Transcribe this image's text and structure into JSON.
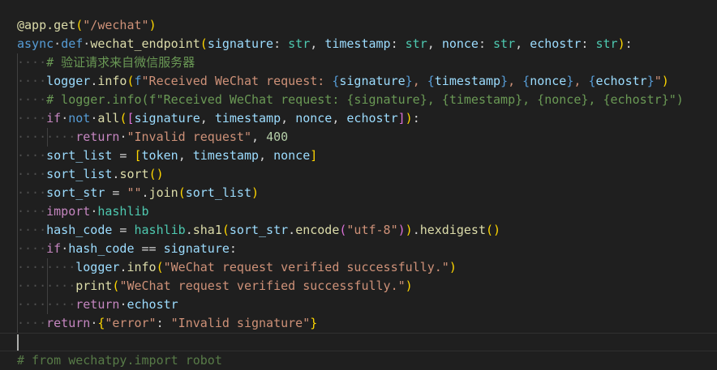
{
  "editor": {
    "lines": [
      {
        "indent": 0,
        "tokens": [
          {
            "t": "@app.get",
            "c": "decorator"
          },
          {
            "t": "(",
            "c": "b1"
          },
          {
            "t": "\"/wechat\"",
            "c": "string"
          },
          {
            "t": ")",
            "c": "b1"
          }
        ]
      },
      {
        "indent": 0,
        "tokens": [
          {
            "t": "async",
            "c": "keyword"
          },
          {
            "t": " ",
            "c": "ws"
          },
          {
            "t": "def",
            "c": "keyword"
          },
          {
            "t": " ",
            "c": "ws"
          },
          {
            "t": "wechat_endpoint",
            "c": "func"
          },
          {
            "t": "(",
            "c": "b1"
          },
          {
            "t": "signature",
            "c": "var"
          },
          {
            "t": ": ",
            "c": "op"
          },
          {
            "t": "str",
            "c": "type"
          },
          {
            "t": ", ",
            "c": "op"
          },
          {
            "t": "timestamp",
            "c": "var"
          },
          {
            "t": ": ",
            "c": "op"
          },
          {
            "t": "str",
            "c": "type"
          },
          {
            "t": ", ",
            "c": "op"
          },
          {
            "t": "nonce",
            "c": "var"
          },
          {
            "t": ": ",
            "c": "op"
          },
          {
            "t": "str",
            "c": "type"
          },
          {
            "t": ", ",
            "c": "op"
          },
          {
            "t": "echostr",
            "c": "var"
          },
          {
            "t": ": ",
            "c": "op"
          },
          {
            "t": "str",
            "c": "type"
          },
          {
            "t": ")",
            "c": "b1"
          },
          {
            "t": ":",
            "c": "op"
          }
        ]
      },
      {
        "indent": 1,
        "tokens": [
          {
            "t": "# 验证请求来自微信服务器",
            "c": "comment"
          }
        ]
      },
      {
        "indent": 1,
        "tokens": [
          {
            "t": "logger",
            "c": "var"
          },
          {
            "t": ".",
            "c": "op"
          },
          {
            "t": "info",
            "c": "func"
          },
          {
            "t": "(",
            "c": "b1"
          },
          {
            "t": "f",
            "c": "keyword"
          },
          {
            "t": "\"Received WeChat request: ",
            "c": "string"
          },
          {
            "t": "{",
            "c": "keyword"
          },
          {
            "t": "signature",
            "c": "var"
          },
          {
            "t": "}",
            "c": "keyword"
          },
          {
            "t": ", ",
            "c": "string"
          },
          {
            "t": "{",
            "c": "keyword"
          },
          {
            "t": "timestamp",
            "c": "var"
          },
          {
            "t": "}",
            "c": "keyword"
          },
          {
            "t": ", ",
            "c": "string"
          },
          {
            "t": "{",
            "c": "keyword"
          },
          {
            "t": "nonce",
            "c": "var"
          },
          {
            "t": "}",
            "c": "keyword"
          },
          {
            "t": ", ",
            "c": "string"
          },
          {
            "t": "{",
            "c": "keyword"
          },
          {
            "t": "echostr",
            "c": "var"
          },
          {
            "t": "}",
            "c": "keyword"
          },
          {
            "t": "\"",
            "c": "string"
          },
          {
            "t": ")",
            "c": "b1"
          }
        ]
      },
      {
        "indent": 1,
        "tokens": [
          {
            "t": "# logger.info(f\"Received WeChat request: {signature}, {timestamp}, {nonce}, {echostr}\")",
            "c": "comment"
          }
        ]
      },
      {
        "indent": 1,
        "tokens": [
          {
            "t": "if",
            "c": "control"
          },
          {
            "t": " ",
            "c": "ws"
          },
          {
            "t": "not",
            "c": "keyword"
          },
          {
            "t": " ",
            "c": "ws"
          },
          {
            "t": "all",
            "c": "func"
          },
          {
            "t": "(",
            "c": "b1"
          },
          {
            "t": "[",
            "c": "b2"
          },
          {
            "t": "signature",
            "c": "var"
          },
          {
            "t": ", ",
            "c": "op"
          },
          {
            "t": "timestamp",
            "c": "var"
          },
          {
            "t": ", ",
            "c": "op"
          },
          {
            "t": "nonce",
            "c": "var"
          },
          {
            "t": ", ",
            "c": "op"
          },
          {
            "t": "echostr",
            "c": "var"
          },
          {
            "t": "]",
            "c": "b2"
          },
          {
            "t": ")",
            "c": "b1"
          },
          {
            "t": ":",
            "c": "op"
          }
        ]
      },
      {
        "indent": 2,
        "tokens": [
          {
            "t": "return",
            "c": "control"
          },
          {
            "t": " ",
            "c": "ws"
          },
          {
            "t": "\"Invalid request\"",
            "c": "string"
          },
          {
            "t": ", ",
            "c": "op"
          },
          {
            "t": "400",
            "c": "number"
          }
        ]
      },
      {
        "indent": 1,
        "tokens": [
          {
            "t": "sort_list",
            "c": "var"
          },
          {
            "t": " = ",
            "c": "op"
          },
          {
            "t": "[",
            "c": "b1"
          },
          {
            "t": "token",
            "c": "var"
          },
          {
            "t": ", ",
            "c": "op"
          },
          {
            "t": "timestamp",
            "c": "var"
          },
          {
            "t": ", ",
            "c": "op"
          },
          {
            "t": "nonce",
            "c": "var"
          },
          {
            "t": "]",
            "c": "b1"
          }
        ]
      },
      {
        "indent": 1,
        "tokens": [
          {
            "t": "sort_list",
            "c": "var"
          },
          {
            "t": ".",
            "c": "op"
          },
          {
            "t": "sort",
            "c": "func"
          },
          {
            "t": "()",
            "c": "b1"
          }
        ]
      },
      {
        "indent": 1,
        "tokens": [
          {
            "t": "sort_str",
            "c": "var"
          },
          {
            "t": " = ",
            "c": "op"
          },
          {
            "t": "\"\"",
            "c": "string"
          },
          {
            "t": ".",
            "c": "op"
          },
          {
            "t": "join",
            "c": "func"
          },
          {
            "t": "(",
            "c": "b1"
          },
          {
            "t": "sort_list",
            "c": "var"
          },
          {
            "t": ")",
            "c": "b1"
          }
        ]
      },
      {
        "indent": 1,
        "tokens": [
          {
            "t": "import",
            "c": "control"
          },
          {
            "t": " ",
            "c": "ws"
          },
          {
            "t": "hashlib",
            "c": "type"
          }
        ]
      },
      {
        "indent": 1,
        "tokens": [
          {
            "t": "hash_code",
            "c": "var"
          },
          {
            "t": " = ",
            "c": "op"
          },
          {
            "t": "hashlib",
            "c": "type"
          },
          {
            "t": ".",
            "c": "op"
          },
          {
            "t": "sha1",
            "c": "func"
          },
          {
            "t": "(",
            "c": "b1"
          },
          {
            "t": "sort_str",
            "c": "var"
          },
          {
            "t": ".",
            "c": "op"
          },
          {
            "t": "encode",
            "c": "func"
          },
          {
            "t": "(",
            "c": "b2"
          },
          {
            "t": "\"utf-8\"",
            "c": "string"
          },
          {
            "t": ")",
            "c": "b2"
          },
          {
            "t": ")",
            "c": "b1"
          },
          {
            "t": ".",
            "c": "op"
          },
          {
            "t": "hexdigest",
            "c": "func"
          },
          {
            "t": "()",
            "c": "b1"
          }
        ]
      },
      {
        "indent": 1,
        "tokens": [
          {
            "t": "if",
            "c": "control"
          },
          {
            "t": " ",
            "c": "ws"
          },
          {
            "t": "hash_code",
            "c": "var"
          },
          {
            "t": " == ",
            "c": "op"
          },
          {
            "t": "signature",
            "c": "var"
          },
          {
            "t": ":",
            "c": "op"
          }
        ]
      },
      {
        "indent": 2,
        "tokens": [
          {
            "t": "logger",
            "c": "var"
          },
          {
            "t": ".",
            "c": "op"
          },
          {
            "t": "info",
            "c": "func"
          },
          {
            "t": "(",
            "c": "b1"
          },
          {
            "t": "\"WeChat request verified successfully.\"",
            "c": "string"
          },
          {
            "t": ")",
            "c": "b1"
          }
        ]
      },
      {
        "indent": 2,
        "tokens": [
          {
            "t": "print",
            "c": "func"
          },
          {
            "t": "(",
            "c": "b1"
          },
          {
            "t": "\"WeChat request verified successfully.\"",
            "c": "string"
          },
          {
            "t": ")",
            "c": "b1"
          }
        ]
      },
      {
        "indent": 2,
        "tokens": [
          {
            "t": "return",
            "c": "control"
          },
          {
            "t": " ",
            "c": "ws"
          },
          {
            "t": "echostr",
            "c": "var"
          }
        ]
      },
      {
        "indent": 1,
        "tokens": [
          {
            "t": "return",
            "c": "control"
          },
          {
            "t": " ",
            "c": "ws"
          },
          {
            "t": "{",
            "c": "b1"
          },
          {
            "t": "\"error\"",
            "c": "string"
          },
          {
            "t": ": ",
            "c": "op"
          },
          {
            "t": "\"Invalid signature\"",
            "c": "string"
          },
          {
            "t": "}",
            "c": "b1"
          }
        ]
      },
      {
        "indent": 0,
        "current": true,
        "tokens": []
      },
      {
        "indent": 0,
        "dim": true,
        "tokens": [
          {
            "t": "# from wechatpy.import robot",
            "c": "comment"
          }
        ]
      }
    ]
  }
}
